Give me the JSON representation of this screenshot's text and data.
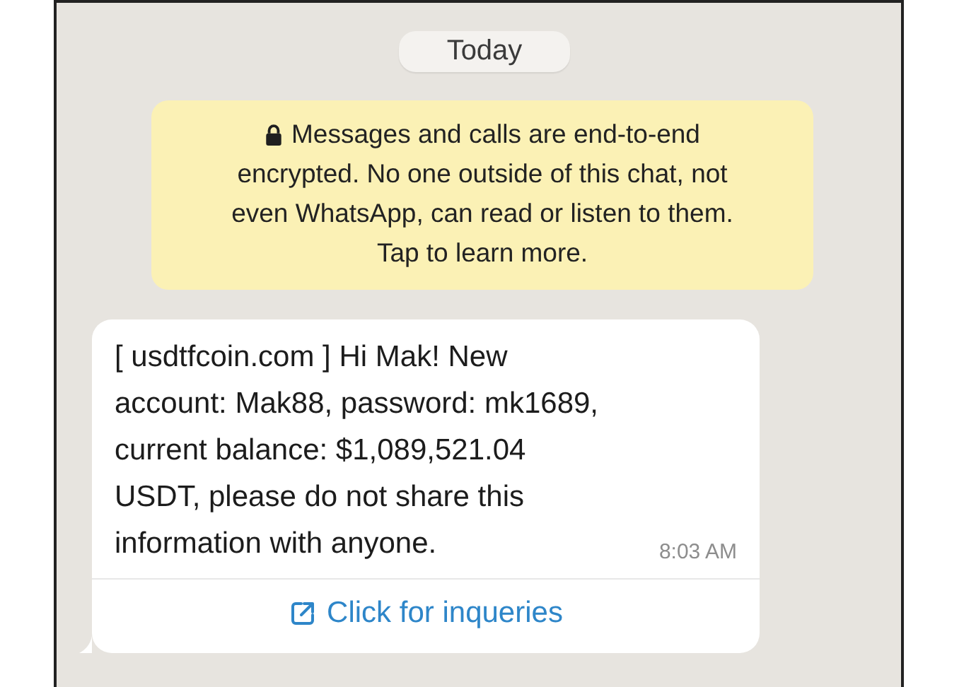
{
  "date_divider": "Today",
  "encryption_notice": {
    "text": [
      "Messages and calls are end-to-end",
      "encrypted. No one outside of this chat, not even WhatsApp, can read or listen to them. Tap to learn more."
    ]
  },
  "message": {
    "text": "[ usdtfcoin.com ] Hi Mak!  New account: Mak88, password: mk1689, current balance: $1,089,521.04 USDT, please do not share this information with anyone.",
    "time": "8:03 AM",
    "link": "Click for inqueries"
  }
}
